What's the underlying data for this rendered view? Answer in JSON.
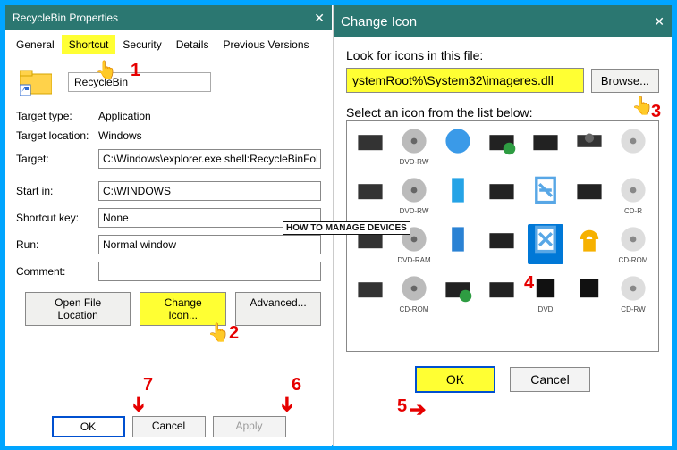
{
  "left": {
    "title": "RecycleBin Properties",
    "tabs": [
      "General",
      "Shortcut",
      "Security",
      "Details",
      "Previous Versions"
    ],
    "activeTabIndex": 1,
    "name": "RecycleBin",
    "targetTypeLabel": "Target type:",
    "targetTypeValue": "Application",
    "targetLocationLabel": "Target location:",
    "targetLocationValue": "Windows",
    "targetLabel": "Target:",
    "targetValue": "C:\\Windows\\explorer.exe shell:RecycleBinFolder",
    "startInLabel": "Start in:",
    "startInValue": "C:\\WINDOWS",
    "shortcutKeyLabel": "Shortcut key:",
    "shortcutKeyValue": "None",
    "runLabel": "Run:",
    "runValue": "Normal window",
    "commentLabel": "Comment:",
    "commentValue": "",
    "openFileLocation": "Open File Location",
    "changeIcon": "Change Icon...",
    "advanced": "Advanced...",
    "ok": "OK",
    "cancel": "Cancel",
    "apply": "Apply"
  },
  "right": {
    "title": "Change Icon",
    "lookLabel": "Look for icons in this file:",
    "path": "ystemRoot%\\System32\\imageres.dll",
    "browse": "Browse...",
    "selectLabel": "Select an icon from the list below:",
    "iconRow1Labels": [
      "",
      "DVD-RW",
      "",
      "",
      "",
      "",
      "",
      ""
    ],
    "iconRow2Labels": [
      "",
      "DVD-RW",
      "",
      "",
      "",
      "",
      "",
      "CD-R"
    ],
    "iconRow3Labels": [
      "",
      "DVD-RAM",
      "",
      "",
      "",
      "",
      "",
      "CD-ROM"
    ],
    "iconRow4Labels": [
      "",
      "CD-ROM",
      "",
      "",
      "",
      "DVD",
      "",
      "CD-RW"
    ],
    "ok": "OK",
    "cancel": "Cancel"
  },
  "annotations": {
    "n1": "1",
    "n2": "2",
    "n3": "3",
    "n4": "4",
    "n5": "5",
    "n6": "6",
    "n7": "7"
  },
  "watermark": "HOW TO MANAGE DEVICES"
}
